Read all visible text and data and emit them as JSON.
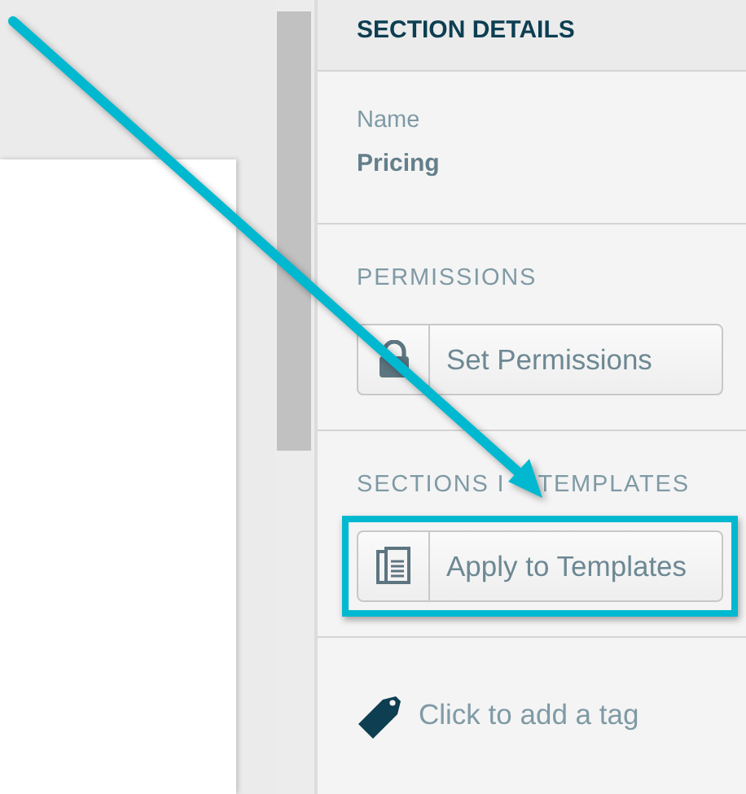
{
  "panel": {
    "title": "SECTION DETAILS"
  },
  "sections": [
    {
      "kind": "field",
      "label": "Name",
      "value": "Pricing"
    },
    {
      "kind": "action",
      "label": "PERMISSIONS",
      "button": {
        "text": "Set Permissions",
        "highlighted": false
      }
    },
    {
      "kind": "action",
      "label": "SECTIONS I",
      "label_after_arrow": "TEMPLATES",
      "button": {
        "text": "Apply to Templates",
        "highlighted": true
      }
    },
    {
      "kind": "tag",
      "text": "Click to add a tag"
    }
  ],
  "annotation": {
    "kind": "arrow"
  }
}
